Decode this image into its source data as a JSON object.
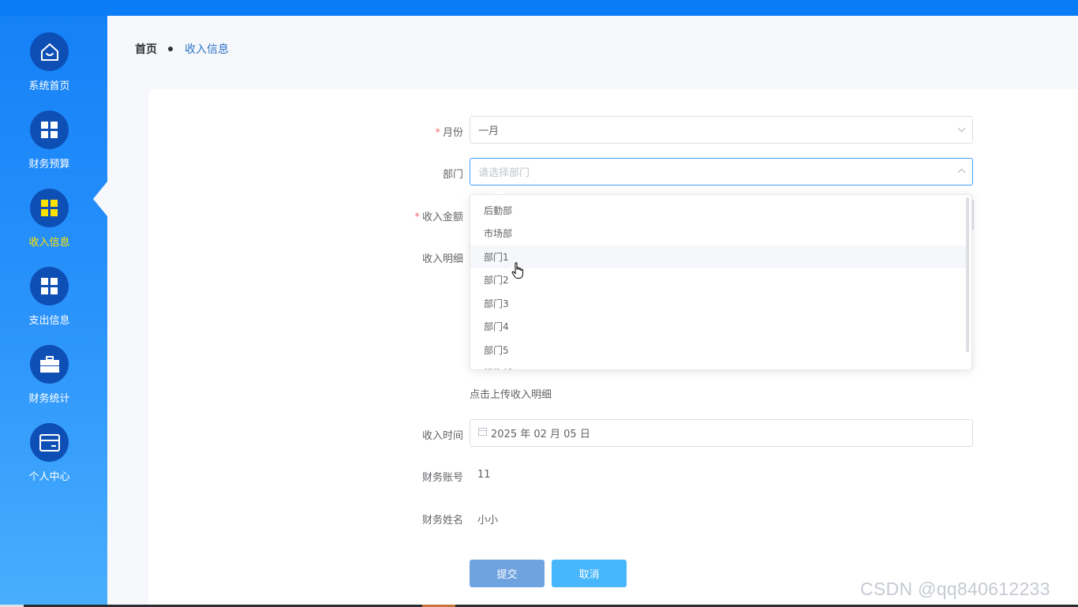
{
  "sidebar": {
    "items": [
      {
        "label": "系统首页",
        "icon": "home-icon"
      },
      {
        "label": "财务预算",
        "icon": "grid-icon"
      },
      {
        "label": "收入信息",
        "icon": "grid-icon",
        "active": true
      },
      {
        "label": "支出信息",
        "icon": "grid-icon"
      },
      {
        "label": "财务统计",
        "icon": "briefcase-icon"
      },
      {
        "label": "个人中心",
        "icon": "card-icon"
      }
    ],
    "active_color": "#ffe300"
  },
  "breadcrumb": {
    "home": "首页",
    "current": "收入信息"
  },
  "form": {
    "month": {
      "label": "月份",
      "required": true,
      "value": "一月"
    },
    "department": {
      "label": "部门",
      "placeholder": "请选择部门",
      "options": [
        "后勤部",
        "市场部",
        "部门1",
        "部门2",
        "部门3",
        "部门4",
        "部门5",
        "销售部"
      ],
      "hovered": "部门1"
    },
    "amount": {
      "label": "收入金额",
      "required": true
    },
    "detail": {
      "label": "收入明细",
      "upload_text": "点击上传收入明细"
    },
    "time": {
      "label": "收入时间",
      "value": "2025 年 02 月 05 日"
    },
    "account": {
      "label": "财务账号",
      "value": "11"
    },
    "name": {
      "label": "财务姓名",
      "value": "小小"
    },
    "submit_label": "提交",
    "cancel_label": "取消"
  },
  "watermark": "CSDN @qq840612233"
}
